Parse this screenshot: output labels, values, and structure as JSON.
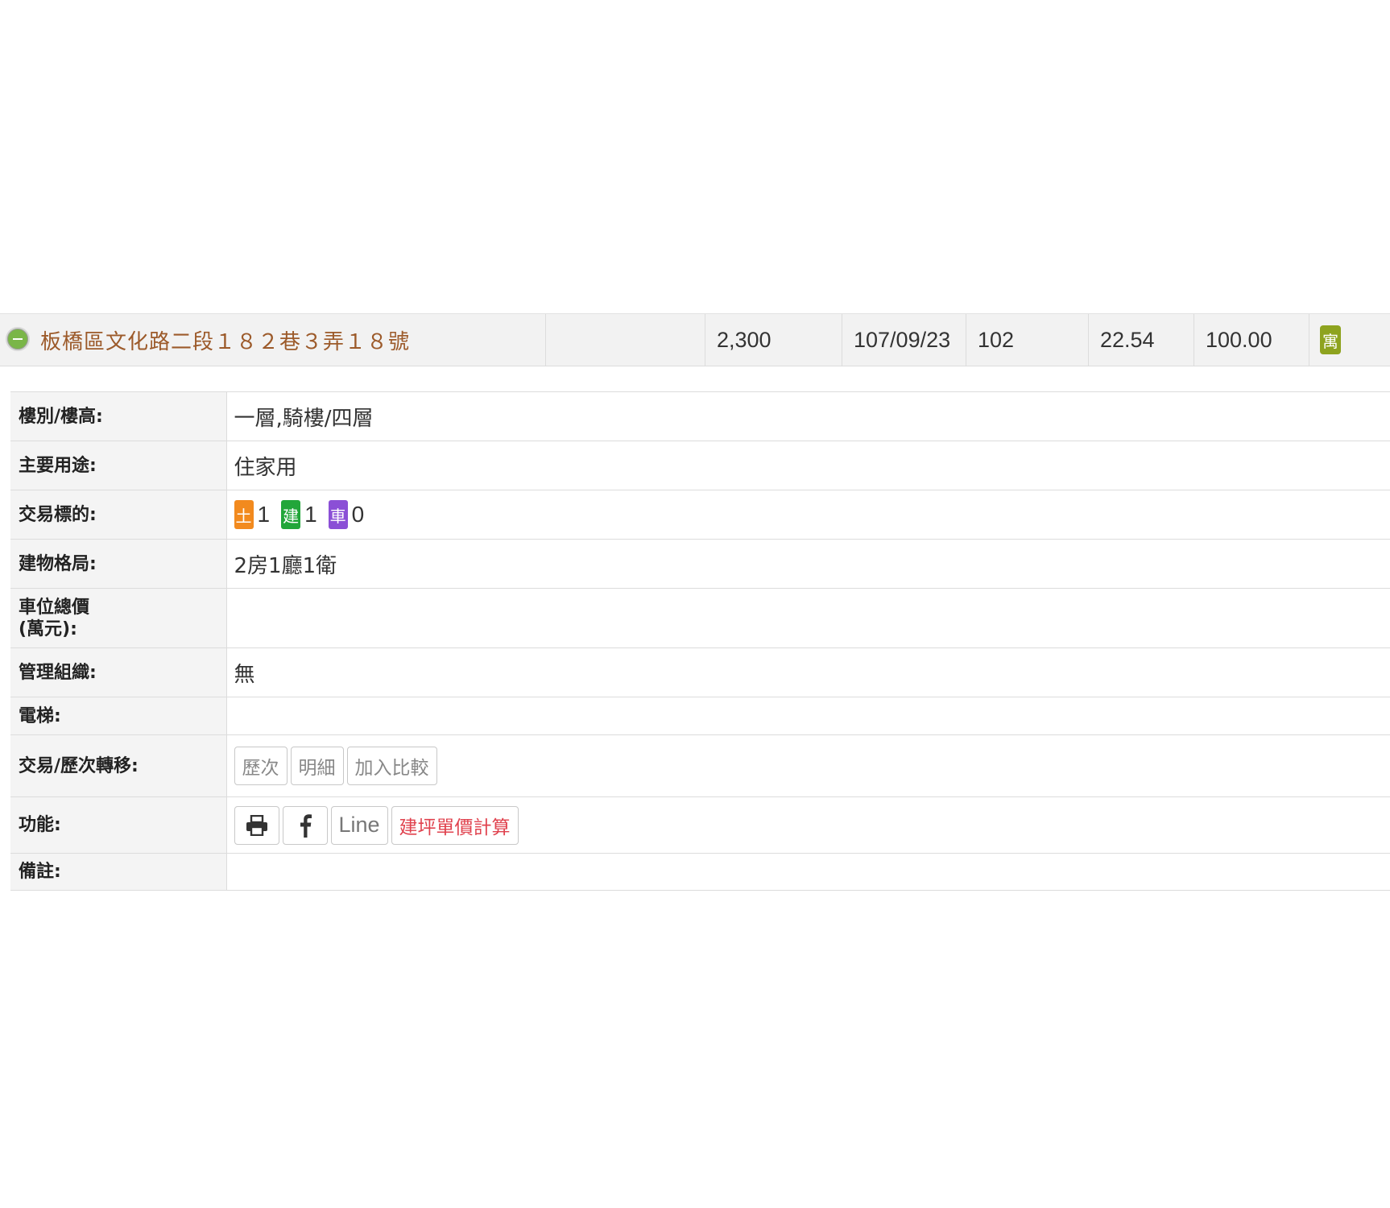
{
  "summary": {
    "address": "板橋區文化路二段１８２巷３弄１８號",
    "total_price": "2,300",
    "date": "107/09/23",
    "floor_area_label": "102",
    "area": "22.54",
    "unit_value": "100.00",
    "type_badge": "寓",
    "type_badge_color": "#8ea31f",
    "address_color": "#9c5a2a"
  },
  "details": {
    "floor": {
      "label": "樓別/樓高:",
      "value": "一層,騎樓/四層"
    },
    "usage": {
      "label": "主要用途:",
      "value": "住家用"
    },
    "target": {
      "label": "交易標的:",
      "items": [
        {
          "tag": "土",
          "count": "1",
          "color": "#f28a1e"
        },
        {
          "tag": "建",
          "count": "1",
          "color": "#22a63a"
        },
        {
          "tag": "車",
          "count": "0",
          "color": "#8b4fd6"
        }
      ]
    },
    "layout": {
      "label": "建物格局:",
      "value": "2房1廳1衛"
    },
    "parking_price": {
      "label_line1": "車位總價",
      "label_line2": "(萬元):",
      "value": ""
    },
    "management": {
      "label": "管理組織:",
      "value": "無"
    },
    "elevator": {
      "label": "電梯:",
      "value": ""
    },
    "transfer": {
      "label": "交易/歷次轉移:",
      "buttons": [
        "歷次",
        "明細",
        "加入比較"
      ]
    },
    "functions": {
      "label": "功能:",
      "print_icon": "printer-icon",
      "facebook_icon": "facebook-icon",
      "line_label": "Line",
      "calc_label": "建坪單價計算"
    },
    "notes": {
      "label": "備註:",
      "value": ""
    }
  }
}
